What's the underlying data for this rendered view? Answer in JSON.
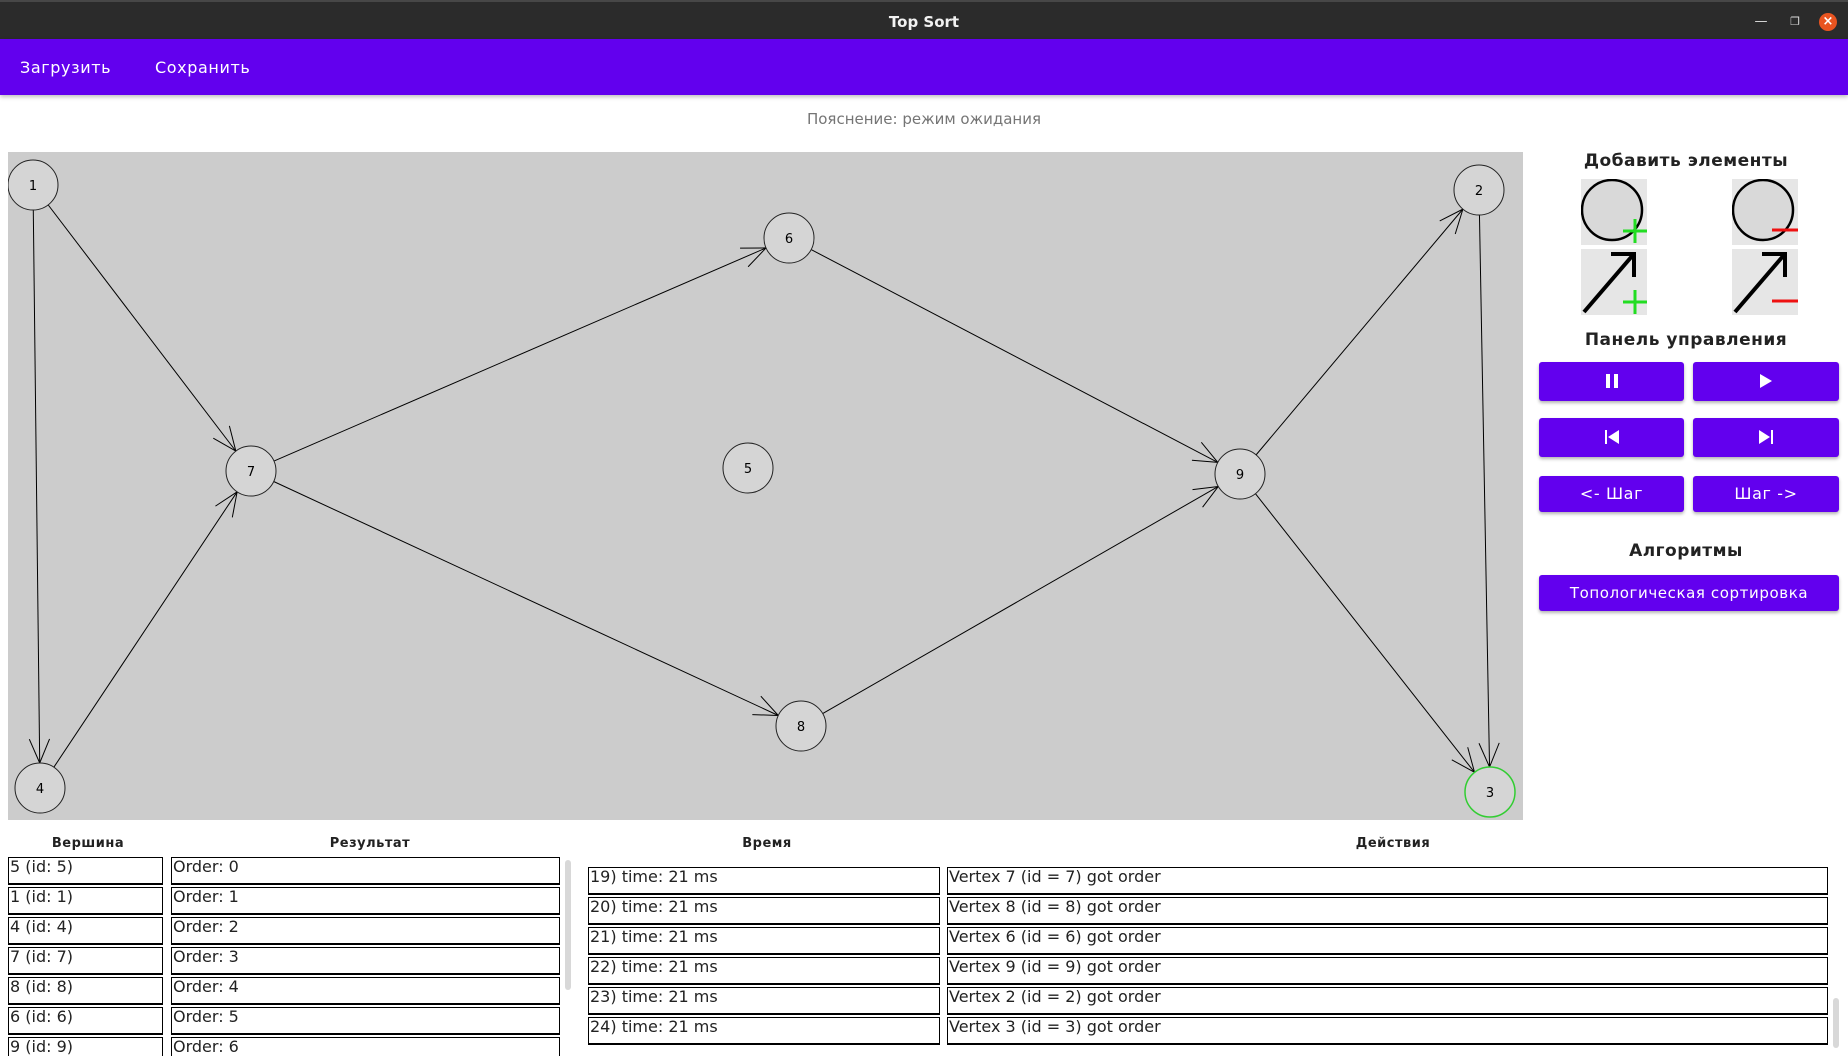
{
  "window": {
    "title": "Top Sort"
  },
  "menu": {
    "load": "Загрузить",
    "save": "Сохранить"
  },
  "hint": "Пояснение: режим ожидания",
  "graph": {
    "vertices": [
      {
        "label": "1",
        "active": false
      },
      {
        "label": "2",
        "active": false
      },
      {
        "label": "3",
        "active": true
      },
      {
        "label": "4",
        "active": false
      },
      {
        "label": "5",
        "active": false
      },
      {
        "label": "6",
        "active": false
      },
      {
        "label": "7",
        "active": false
      },
      {
        "label": "8",
        "active": false
      },
      {
        "label": "9",
        "active": false
      }
    ],
    "edges": [
      {
        "from": "1",
        "to": "4"
      },
      {
        "from": "1",
        "to": "7"
      },
      {
        "from": "4",
        "to": "7"
      },
      {
        "from": "7",
        "to": "6"
      },
      {
        "from": "7",
        "to": "8"
      },
      {
        "from": "6",
        "to": "9"
      },
      {
        "from": "8",
        "to": "9"
      },
      {
        "from": "9",
        "to": "2"
      },
      {
        "from": "9",
        "to": "3"
      },
      {
        "from": "2",
        "to": "3"
      }
    ],
    "active_color": "#32cd32"
  },
  "panel": {
    "add_title": "Добавить элементы",
    "control_title": "Панель управления",
    "algorithms_title": "Алгоритмы",
    "step_back": "<- Шаг",
    "step_forward": "Шаг ->",
    "topo_sort": "Топологическая сортировка",
    "accent": "#6200ee"
  },
  "tables": {
    "headers": {
      "vertex": "Вершина",
      "result": "Результат",
      "time": "Время",
      "actions": "Действия"
    },
    "vertices": [
      "5 (id: 5)",
      "1 (id: 1)",
      "4 (id: 4)",
      "7 (id: 7)",
      "8 (id: 8)",
      "6 (id: 6)",
      "9 (id: 9)"
    ],
    "results": [
      "Order: 0",
      "Order: 1",
      "Order: 2",
      "Order: 3",
      "Order: 4",
      "Order: 5",
      "Order: 6"
    ],
    "times": [
      "19) time: 21 ms",
      "20) time: 21 ms",
      "21) time: 21 ms",
      "22) time: 21 ms",
      "23) time: 21 ms",
      "24) time: 21 ms"
    ],
    "actions": [
      "Vertex 7 (id = 7) got order",
      "Vertex 8 (id = 8) got order",
      "Vertex 6 (id = 6) got order",
      "Vertex 9 (id = 9) got order",
      "Vertex 2 (id = 2) got order",
      "Vertex 3 (id = 3) got order"
    ]
  }
}
